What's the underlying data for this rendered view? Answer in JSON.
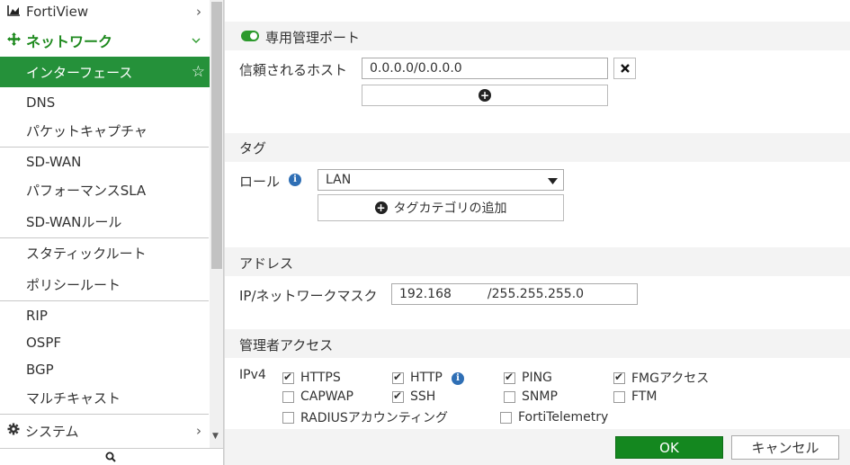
{
  "sidebar": {
    "fortiview": "FortiView",
    "network": "ネットワーク",
    "items": {
      "interfaces": "インターフェース",
      "dns": "DNS",
      "packet_capture": "パケットキャプチャ",
      "sdwan": "SD-WAN",
      "performance_sla": "パフォーマンスSLA",
      "sdwan_rules": "SD-WANルール",
      "static_routes": "スタティックルート",
      "policy_routes": "ポリシールート",
      "rip": "RIP",
      "ospf": "OSPF",
      "bgp": "BGP",
      "multicast": "マルチキャスト"
    },
    "system": "システム"
  },
  "main": {
    "dedicated_mgmt_port": "専用管理ポート",
    "trusted_hosts_label": "信頼されるホスト",
    "trusted_host_value": "0.0.0.0/0.0.0.0",
    "tags_section": "タグ",
    "role_label": "ロール",
    "role_value": "LAN",
    "add_tag_category": "タグカテゴリの追加",
    "address_section": "アドレス",
    "ip_netmask_label": "IP/ネットワークマスク",
    "ip_value": "192.168",
    "mask_value": "/255.255.255.0",
    "admin_access_section": "管理者アクセス",
    "ipv4_label": "IPv4",
    "access": {
      "https": "HTTPS",
      "http": "HTTP",
      "ping": "PING",
      "fmg": "FMGアクセス",
      "capwap": "CAPWAP",
      "ssh": "SSH",
      "snmp": "SNMP",
      "ftm": "FTM",
      "radius": "RADIUSアカウンティング",
      "fortitelemetry": "FortiTelemetry"
    },
    "access_checked": {
      "https": true,
      "http": true,
      "ping": true,
      "fmg": true,
      "capwap": false,
      "ssh": true,
      "snmp": false,
      "ftm": false,
      "radius": false,
      "fortitelemetry": false
    }
  },
  "buttons": {
    "ok": "OK",
    "cancel": "キャンセル"
  },
  "colors": {
    "accent_green": "#25913a",
    "ok_green": "#14871f",
    "info_blue": "#2f6fb5"
  }
}
